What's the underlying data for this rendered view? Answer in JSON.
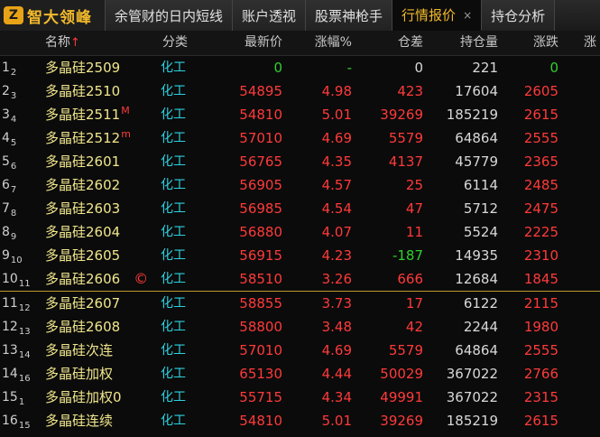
{
  "app": {
    "logo_mark": "Z",
    "logo_text": "智大领峰"
  },
  "tabs": [
    {
      "label": "余管财的日内短线",
      "active": false
    },
    {
      "label": "账户透视",
      "active": false
    },
    {
      "label": "股票神枪手",
      "active": false
    },
    {
      "label": "行情报价",
      "active": true,
      "close": "×"
    },
    {
      "label": "持仓分析",
      "active": false
    }
  ],
  "header": {
    "name": "名称",
    "sort_arrow": "↑",
    "category": "分类",
    "latest": "最新价",
    "change_pct": "涨幅%",
    "oi_diff": "仓差",
    "open_interest": "持仓量",
    "change": "涨跌",
    "overflow": "涨"
  },
  "rows": [
    {
      "idx": "1",
      "sub": "2",
      "name": "多晶硅2509",
      "mark": "",
      "copy": "",
      "category": "化工",
      "latest": "0",
      "pct": "-",
      "diff": "0",
      "oi": "221",
      "chg": "0",
      "latest_color": "green",
      "pct_color": "green",
      "diff_color": "white",
      "chg_color": "green"
    },
    {
      "idx": "2",
      "sub": "3",
      "name": "多晶硅2510",
      "mark": "",
      "copy": "",
      "category": "化工",
      "latest": "54895",
      "pct": "4.98",
      "diff": "423",
      "oi": "17604",
      "chg": "2605",
      "latest_color": "red",
      "pct_color": "red",
      "diff_color": "red",
      "chg_color": "red"
    },
    {
      "idx": "3",
      "sub": "4",
      "name": "多晶硅2511",
      "mark": "M",
      "copy": "",
      "category": "化工",
      "latest": "54810",
      "pct": "5.01",
      "diff": "39269",
      "oi": "185219",
      "chg": "2615",
      "latest_color": "red",
      "pct_color": "red",
      "diff_color": "red",
      "chg_color": "red"
    },
    {
      "idx": "4",
      "sub": "5",
      "name": "多晶硅2512",
      "mark": "m",
      "copy": "",
      "category": "化工",
      "latest": "57010",
      "pct": "4.69",
      "diff": "5579",
      "oi": "64864",
      "chg": "2555",
      "latest_color": "red",
      "pct_color": "red",
      "diff_color": "red",
      "chg_color": "red"
    },
    {
      "idx": "5",
      "sub": "6",
      "name": "多晶硅2601",
      "mark": "",
      "copy": "",
      "category": "化工",
      "latest": "56765",
      "pct": "4.35",
      "diff": "4137",
      "oi": "45779",
      "chg": "2365",
      "latest_color": "red",
      "pct_color": "red",
      "diff_color": "red",
      "chg_color": "red"
    },
    {
      "idx": "6",
      "sub": "7",
      "name": "多晶硅2602",
      "mark": "",
      "copy": "",
      "category": "化工",
      "latest": "56905",
      "pct": "4.57",
      "diff": "25",
      "oi": "6114",
      "chg": "2485",
      "latest_color": "red",
      "pct_color": "red",
      "diff_color": "red",
      "chg_color": "red"
    },
    {
      "idx": "7",
      "sub": "8",
      "name": "多晶硅2603",
      "mark": "",
      "copy": "",
      "category": "化工",
      "latest": "56985",
      "pct": "4.54",
      "diff": "47",
      "oi": "5712",
      "chg": "2475",
      "latest_color": "red",
      "pct_color": "red",
      "diff_color": "red",
      "chg_color": "red"
    },
    {
      "idx": "8",
      "sub": "9",
      "name": "多晶硅2604",
      "mark": "",
      "copy": "",
      "category": "化工",
      "latest": "56880",
      "pct": "4.07",
      "diff": "11",
      "oi": "5524",
      "chg": "2225",
      "latest_color": "red",
      "pct_color": "red",
      "diff_color": "red",
      "chg_color": "red"
    },
    {
      "idx": "9",
      "sub": "10",
      "name": "多晶硅2605",
      "mark": "",
      "copy": "",
      "category": "化工",
      "latest": "56915",
      "pct": "4.23",
      "diff": "-187",
      "oi": "14935",
      "chg": "2310",
      "latest_color": "red",
      "pct_color": "red",
      "diff_color": "green",
      "chg_color": "red"
    },
    {
      "idx": "10",
      "sub": "11",
      "name": "多晶硅2606",
      "mark": "",
      "copy": "©",
      "category": "化工",
      "latest": "58510",
      "pct": "3.26",
      "diff": "666",
      "oi": "12684",
      "chg": "1845",
      "latest_color": "red",
      "pct_color": "red",
      "diff_color": "red",
      "chg_color": "red"
    },
    {
      "idx": "11",
      "sub": "12",
      "name": "多晶硅2607",
      "mark": "",
      "copy": "",
      "category": "化工",
      "latest": "58855",
      "pct": "3.73",
      "diff": "17",
      "oi": "6122",
      "chg": "2115",
      "latest_color": "red",
      "pct_color": "red",
      "diff_color": "red",
      "chg_color": "red"
    },
    {
      "idx": "12",
      "sub": "13",
      "name": "多晶硅2608",
      "mark": "",
      "copy": "",
      "category": "化工",
      "latest": "58800",
      "pct": "3.48",
      "diff": "42",
      "oi": "2244",
      "chg": "1980",
      "latest_color": "red",
      "pct_color": "red",
      "diff_color": "red",
      "chg_color": "red"
    },
    {
      "idx": "13",
      "sub": "14",
      "name": "多晶硅次连",
      "mark": "",
      "copy": "",
      "category": "化工",
      "latest": "57010",
      "pct": "4.69",
      "diff": "5579",
      "oi": "64864",
      "chg": "2555",
      "latest_color": "red",
      "pct_color": "red",
      "diff_color": "red",
      "chg_color": "red"
    },
    {
      "idx": "14",
      "sub": "16",
      "name": "多晶硅加权",
      "mark": "",
      "copy": "",
      "category": "化工",
      "latest": "65130",
      "pct": "4.44",
      "diff": "50029",
      "oi": "367022",
      "chg": "2766",
      "latest_color": "red",
      "pct_color": "red",
      "diff_color": "red",
      "chg_color": "red"
    },
    {
      "idx": "15",
      "sub": "1",
      "name": "多晶硅加权0",
      "mark": "",
      "copy": "",
      "category": "化工",
      "latest": "55715",
      "pct": "4.34",
      "diff": "49991",
      "oi": "367022",
      "chg": "2315",
      "latest_color": "red",
      "pct_color": "red",
      "diff_color": "red",
      "chg_color": "red"
    },
    {
      "idx": "16",
      "sub": "15",
      "name": "多晶硅连续",
      "mark": "",
      "copy": "",
      "category": "化工",
      "latest": "54810",
      "pct": "5.01",
      "diff": "39269",
      "oi": "185219",
      "chg": "2615",
      "latest_color": "red",
      "pct_color": "red",
      "diff_color": "red",
      "chg_color": "red"
    }
  ],
  "separator_after_row": 10,
  "colors": {
    "up": "#ff3a3a",
    "down": "#2fd02f",
    "name": "#f0e68c",
    "category": "#2ed0e0",
    "accent": "#f2b92b"
  }
}
